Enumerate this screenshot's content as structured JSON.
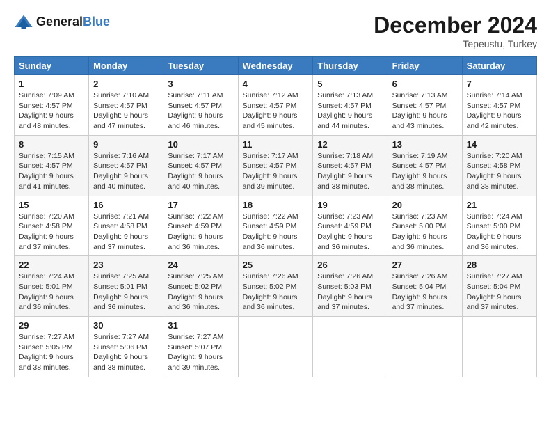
{
  "header": {
    "logo_general": "General",
    "logo_blue": "Blue",
    "month_title": "December 2024",
    "location": "Tepeustu, Turkey"
  },
  "weekdays": [
    "Sunday",
    "Monday",
    "Tuesday",
    "Wednesday",
    "Thursday",
    "Friday",
    "Saturday"
  ],
  "weeks": [
    [
      {
        "day": "1",
        "sunrise": "Sunrise: 7:09 AM",
        "sunset": "Sunset: 4:57 PM",
        "daylight": "Daylight: 9 hours and 48 minutes."
      },
      {
        "day": "2",
        "sunrise": "Sunrise: 7:10 AM",
        "sunset": "Sunset: 4:57 PM",
        "daylight": "Daylight: 9 hours and 47 minutes."
      },
      {
        "day": "3",
        "sunrise": "Sunrise: 7:11 AM",
        "sunset": "Sunset: 4:57 PM",
        "daylight": "Daylight: 9 hours and 46 minutes."
      },
      {
        "day": "4",
        "sunrise": "Sunrise: 7:12 AM",
        "sunset": "Sunset: 4:57 PM",
        "daylight": "Daylight: 9 hours and 45 minutes."
      },
      {
        "day": "5",
        "sunrise": "Sunrise: 7:13 AM",
        "sunset": "Sunset: 4:57 PM",
        "daylight": "Daylight: 9 hours and 44 minutes."
      },
      {
        "day": "6",
        "sunrise": "Sunrise: 7:13 AM",
        "sunset": "Sunset: 4:57 PM",
        "daylight": "Daylight: 9 hours and 43 minutes."
      },
      {
        "day": "7",
        "sunrise": "Sunrise: 7:14 AM",
        "sunset": "Sunset: 4:57 PM",
        "daylight": "Daylight: 9 hours and 42 minutes."
      }
    ],
    [
      {
        "day": "8",
        "sunrise": "Sunrise: 7:15 AM",
        "sunset": "Sunset: 4:57 PM",
        "daylight": "Daylight: 9 hours and 41 minutes."
      },
      {
        "day": "9",
        "sunrise": "Sunrise: 7:16 AM",
        "sunset": "Sunset: 4:57 PM",
        "daylight": "Daylight: 9 hours and 40 minutes."
      },
      {
        "day": "10",
        "sunrise": "Sunrise: 7:17 AM",
        "sunset": "Sunset: 4:57 PM",
        "daylight": "Daylight: 9 hours and 40 minutes."
      },
      {
        "day": "11",
        "sunrise": "Sunrise: 7:17 AM",
        "sunset": "Sunset: 4:57 PM",
        "daylight": "Daylight: 9 hours and 39 minutes."
      },
      {
        "day": "12",
        "sunrise": "Sunrise: 7:18 AM",
        "sunset": "Sunset: 4:57 PM",
        "daylight": "Daylight: 9 hours and 38 minutes."
      },
      {
        "day": "13",
        "sunrise": "Sunrise: 7:19 AM",
        "sunset": "Sunset: 4:57 PM",
        "daylight": "Daylight: 9 hours and 38 minutes."
      },
      {
        "day": "14",
        "sunrise": "Sunrise: 7:20 AM",
        "sunset": "Sunset: 4:58 PM",
        "daylight": "Daylight: 9 hours and 38 minutes."
      }
    ],
    [
      {
        "day": "15",
        "sunrise": "Sunrise: 7:20 AM",
        "sunset": "Sunset: 4:58 PM",
        "daylight": "Daylight: 9 hours and 37 minutes."
      },
      {
        "day": "16",
        "sunrise": "Sunrise: 7:21 AM",
        "sunset": "Sunset: 4:58 PM",
        "daylight": "Daylight: 9 hours and 37 minutes."
      },
      {
        "day": "17",
        "sunrise": "Sunrise: 7:22 AM",
        "sunset": "Sunset: 4:59 PM",
        "daylight": "Daylight: 9 hours and 36 minutes."
      },
      {
        "day": "18",
        "sunrise": "Sunrise: 7:22 AM",
        "sunset": "Sunset: 4:59 PM",
        "daylight": "Daylight: 9 hours and 36 minutes."
      },
      {
        "day": "19",
        "sunrise": "Sunrise: 7:23 AM",
        "sunset": "Sunset: 4:59 PM",
        "daylight": "Daylight: 9 hours and 36 minutes."
      },
      {
        "day": "20",
        "sunrise": "Sunrise: 7:23 AM",
        "sunset": "Sunset: 5:00 PM",
        "daylight": "Daylight: 9 hours and 36 minutes."
      },
      {
        "day": "21",
        "sunrise": "Sunrise: 7:24 AM",
        "sunset": "Sunset: 5:00 PM",
        "daylight": "Daylight: 9 hours and 36 minutes."
      }
    ],
    [
      {
        "day": "22",
        "sunrise": "Sunrise: 7:24 AM",
        "sunset": "Sunset: 5:01 PM",
        "daylight": "Daylight: 9 hours and 36 minutes."
      },
      {
        "day": "23",
        "sunrise": "Sunrise: 7:25 AM",
        "sunset": "Sunset: 5:01 PM",
        "daylight": "Daylight: 9 hours and 36 minutes."
      },
      {
        "day": "24",
        "sunrise": "Sunrise: 7:25 AM",
        "sunset": "Sunset: 5:02 PM",
        "daylight": "Daylight: 9 hours and 36 minutes."
      },
      {
        "day": "25",
        "sunrise": "Sunrise: 7:26 AM",
        "sunset": "Sunset: 5:02 PM",
        "daylight": "Daylight: 9 hours and 36 minutes."
      },
      {
        "day": "26",
        "sunrise": "Sunrise: 7:26 AM",
        "sunset": "Sunset: 5:03 PM",
        "daylight": "Daylight: 9 hours and 37 minutes."
      },
      {
        "day": "27",
        "sunrise": "Sunrise: 7:26 AM",
        "sunset": "Sunset: 5:04 PM",
        "daylight": "Daylight: 9 hours and 37 minutes."
      },
      {
        "day": "28",
        "sunrise": "Sunrise: 7:27 AM",
        "sunset": "Sunset: 5:04 PM",
        "daylight": "Daylight: 9 hours and 37 minutes."
      }
    ],
    [
      {
        "day": "29",
        "sunrise": "Sunrise: 7:27 AM",
        "sunset": "Sunset: 5:05 PM",
        "daylight": "Daylight: 9 hours and 38 minutes."
      },
      {
        "day": "30",
        "sunrise": "Sunrise: 7:27 AM",
        "sunset": "Sunset: 5:06 PM",
        "daylight": "Daylight: 9 hours and 38 minutes."
      },
      {
        "day": "31",
        "sunrise": "Sunrise: 7:27 AM",
        "sunset": "Sunset: 5:07 PM",
        "daylight": "Daylight: 9 hours and 39 minutes."
      },
      null,
      null,
      null,
      null
    ]
  ]
}
